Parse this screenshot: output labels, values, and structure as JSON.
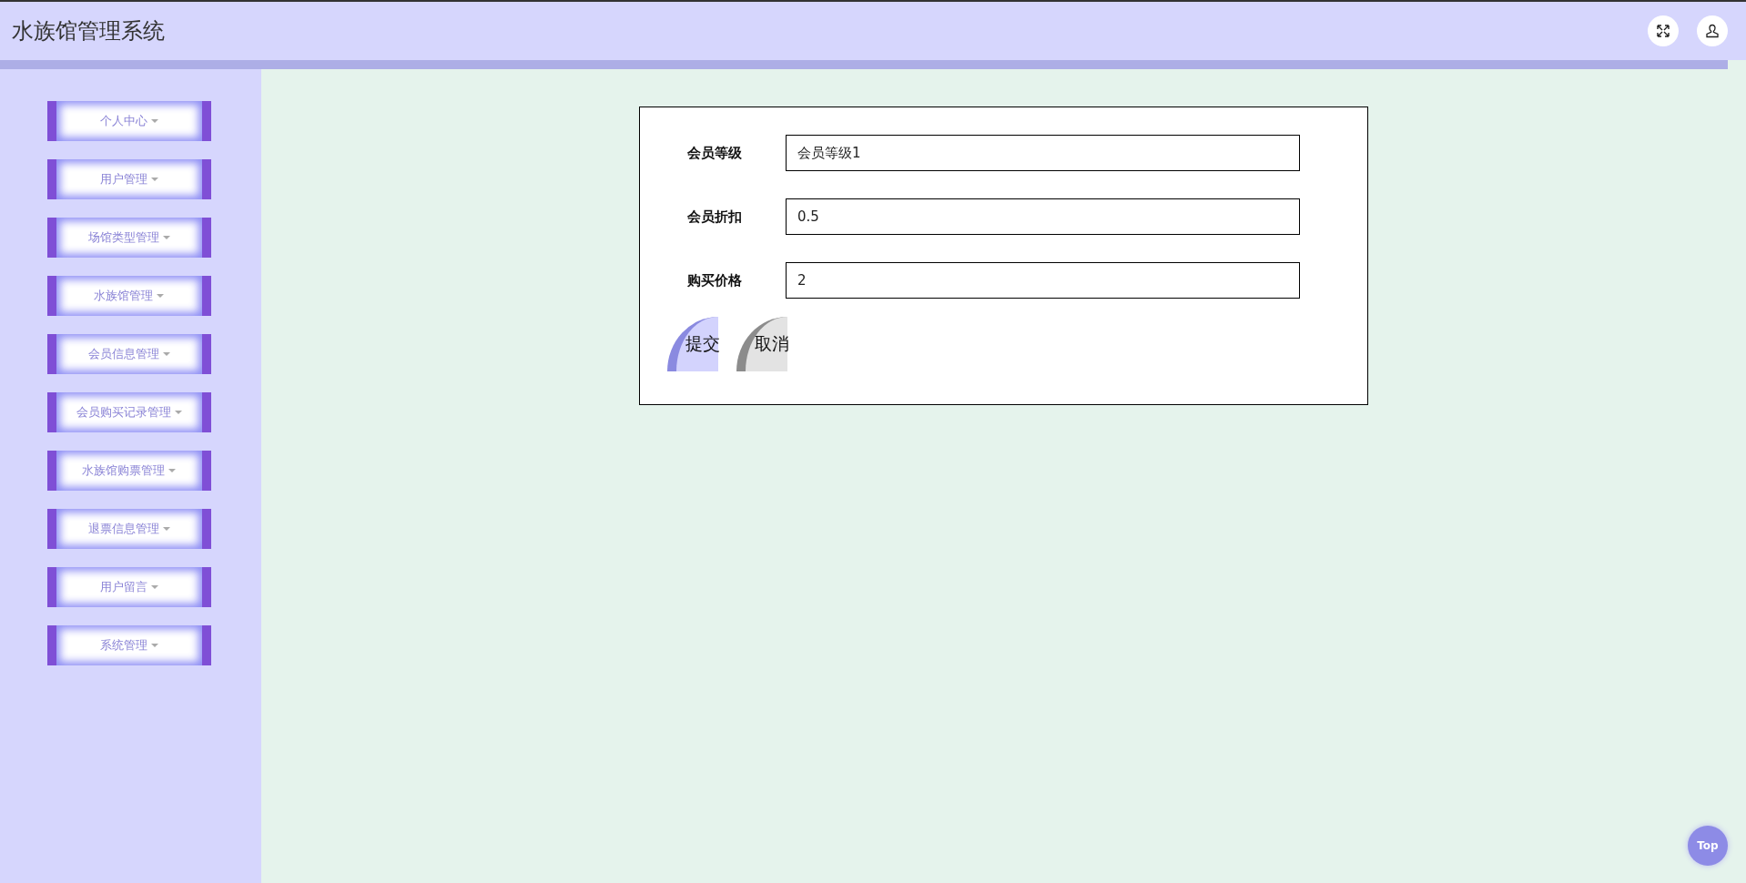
{
  "header": {
    "title": "水族馆管理系统"
  },
  "sidebar": {
    "items": [
      {
        "label": "个人中心"
      },
      {
        "label": "用户管理"
      },
      {
        "label": "场馆类型管理"
      },
      {
        "label": "水族馆管理"
      },
      {
        "label": "会员信息管理"
      },
      {
        "label": "会员购买记录管理"
      },
      {
        "label": "水族馆购票管理"
      },
      {
        "label": "退票信息管理"
      },
      {
        "label": "用户留言"
      },
      {
        "label": "系统管理"
      }
    ]
  },
  "form": {
    "fields": [
      {
        "label": "会员等级",
        "value": "会员等级1"
      },
      {
        "label": "会员折扣",
        "value": "0.5"
      },
      {
        "label": "购买价格",
        "value": "2"
      }
    ],
    "buttons": [
      {
        "label": "提交",
        "kind": "submit"
      },
      {
        "label": "取消",
        "kind": "cancel"
      }
    ]
  },
  "back_to_top": {
    "label": "Top"
  }
}
